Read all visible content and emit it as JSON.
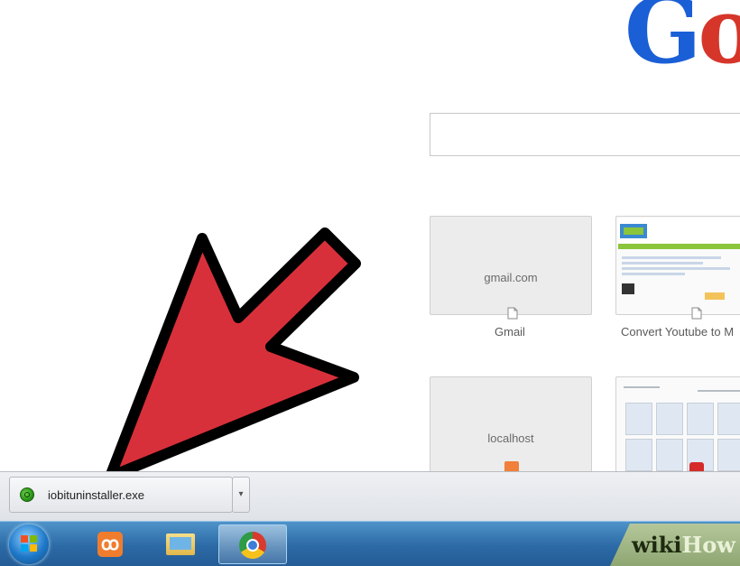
{
  "newtab": {
    "logo_text": {
      "g": "G",
      "o": "o"
    },
    "tiles": [
      {
        "host": "gmail.com",
        "title": "Gmail"
      },
      {
        "host": "",
        "title": "Convert Youtube to M"
      },
      {
        "host": "localhost",
        "title": ""
      }
    ]
  },
  "download_shelf": {
    "item": {
      "filename": "iobituninstaller.exe",
      "icon": "iobit-uninstaller-icon"
    },
    "menu_glyph": "▾"
  },
  "taskbar": {
    "start_icon": "windows-start-icon",
    "items": [
      {
        "name": "xampp-icon",
        "glyph": "ꝏ"
      },
      {
        "name": "folder-icon"
      },
      {
        "name": "chrome-icon",
        "active": true
      }
    ]
  },
  "watermark": {
    "part1": "wiki",
    "part2": "How"
  },
  "annotation": {
    "type": "arrow",
    "color": "#d8303a"
  }
}
